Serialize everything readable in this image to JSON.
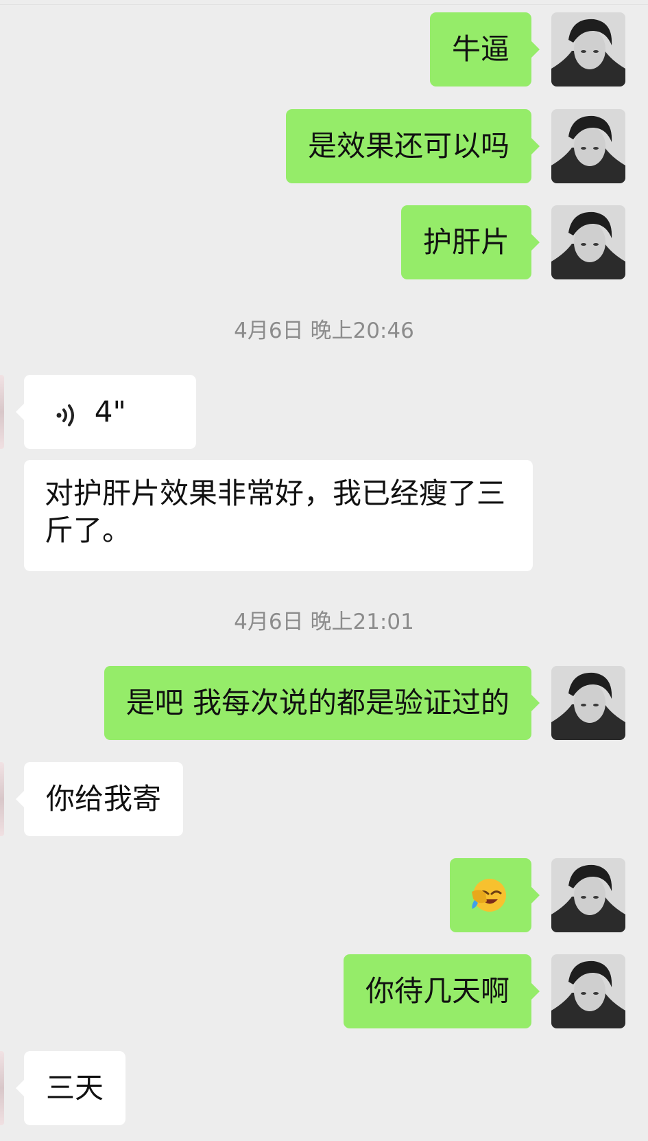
{
  "messages": [
    {
      "from": "me",
      "text": "牛逼"
    },
    {
      "from": "me",
      "text": "是效果还可以吗"
    },
    {
      "from": "me",
      "text": "护肝片"
    },
    {
      "timestamp": "4月6日 晚上20:46"
    },
    {
      "from": "other",
      "type": "voice",
      "duration": "4\""
    },
    {
      "from": "other",
      "text": "对护肝片效果非常好，我已经瘦了三斤了。"
    },
    {
      "timestamp": "4月6日 晚上21:01"
    },
    {
      "from": "me",
      "text": "是吧 我每次说的都是验证过的"
    },
    {
      "from": "other",
      "text": "你给我寄"
    },
    {
      "from": "me",
      "type": "emoji",
      "emoji": "facepalm-laugh-emoji"
    },
    {
      "from": "me",
      "text": "你待几天啊"
    },
    {
      "from": "other",
      "text": "三天"
    }
  ],
  "colors": {
    "background": "#ededed",
    "my_bubble": "#95ec69",
    "other_bubble": "#ffffff",
    "timestamp_text": "#8c8c8c"
  },
  "icons": {
    "voice": "voice-wave-icon",
    "my_avatar": "my-avatar",
    "other_avatar": "contact-avatar"
  }
}
